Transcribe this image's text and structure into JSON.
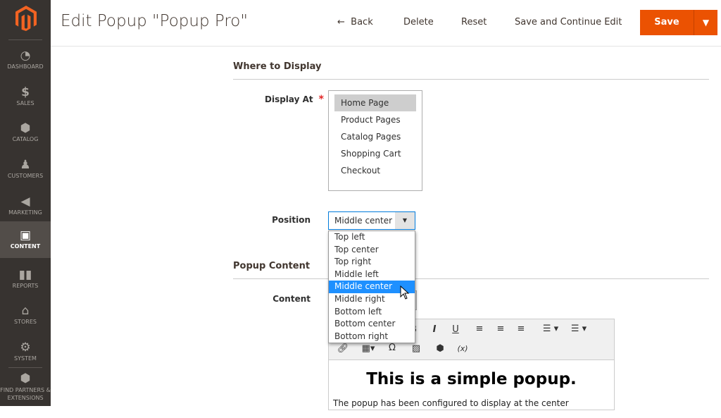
{
  "sidebar": {
    "items": [
      {
        "label": "DASHBOARD",
        "icon": "dashboard-icon"
      },
      {
        "label": "SALES",
        "icon": "dollar-icon"
      },
      {
        "label": "CATALOG",
        "icon": "box-icon"
      },
      {
        "label": "CUSTOMERS",
        "icon": "person-icon"
      },
      {
        "label": "MARKETING",
        "icon": "megaphone-icon"
      },
      {
        "label": "CONTENT",
        "icon": "layout-icon",
        "active": true
      },
      {
        "label": "REPORTS",
        "icon": "bar-chart-icon"
      },
      {
        "label": "STORES",
        "icon": "store-icon"
      },
      {
        "label": "SYSTEM",
        "icon": "gear-icon"
      },
      {
        "label": "FIND PARTNERS & EXTENSIONS",
        "icon": "blocks-icon"
      }
    ]
  },
  "header": {
    "title": "Edit Popup \"Popup Pro\"",
    "back": "Back",
    "delete": "Delete",
    "reset": "Reset",
    "save_continue": "Save and Continue Edit",
    "save": "Save",
    "accent": "#eb5202"
  },
  "where": {
    "title": "Where to Display",
    "display_at_label": "Display At",
    "display_options": [
      "Home Page",
      "Product Pages",
      "Catalog Pages",
      "Shopping Cart",
      "Checkout"
    ],
    "display_selected": "Home Page",
    "position_label": "Position",
    "position_value": "Middle center",
    "position_options": [
      "Top left",
      "Top center",
      "Top right",
      "Middle left",
      "Middle center",
      "Middle right",
      "Bottom left",
      "Bottom center",
      "Bottom right"
    ]
  },
  "content": {
    "title": "Popup Content",
    "content_label": "Content",
    "heading": "This is a simple popup.",
    "body": "The popup has been configured to display at the center"
  }
}
